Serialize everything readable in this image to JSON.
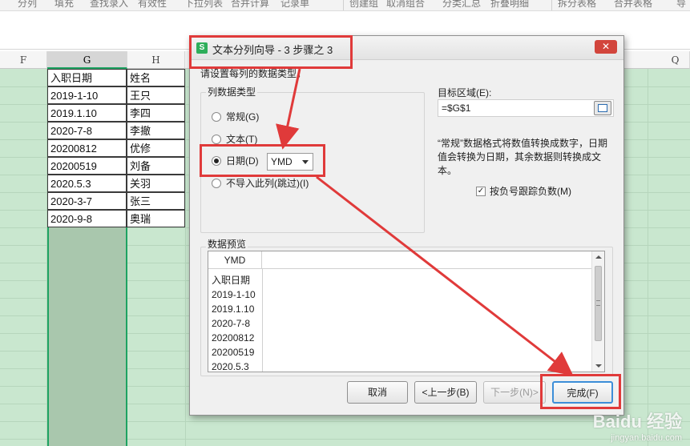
{
  "ribbon": {
    "items": [
      "分列",
      "填充",
      "查找录入",
      "有效性",
      "下拉列表",
      "合并计算",
      "记录单",
      "创建组",
      "取消组合",
      "分类汇总",
      "折叠明细",
      "拆分表格",
      "合并表格",
      "导"
    ]
  },
  "sheet": {
    "columns": [
      "F",
      "G",
      "H",
      "Q"
    ],
    "selected_column": "G",
    "rows": [
      {
        "g": "入职日期",
        "h": "姓名"
      },
      {
        "g": "2019-1-10",
        "h": "王只"
      },
      {
        "g": "2019.1.10",
        "h": "李四"
      },
      {
        "g": "2020-7-8",
        "h": "李撤"
      },
      {
        "g": "20200812",
        "h": "优修"
      },
      {
        "g": "20200519",
        "h": "刘备"
      },
      {
        "g": "2020.5.3",
        "h": "关羽"
      },
      {
        "g": "2020-3-7",
        "h": "张三"
      },
      {
        "g": "2020-9-8",
        "h": "奥瑞"
      }
    ]
  },
  "dialog": {
    "app_icon": "S",
    "title": "文本分列向导 - 3 步骤之 3",
    "close_label": "✕",
    "prompt": "请设置每列的数据类型。",
    "column_type_group": "列数据类型",
    "options": [
      {
        "label": "常规(G)",
        "checked": false
      },
      {
        "label": "文本(T)",
        "checked": false
      },
      {
        "label": "日期(D)",
        "checked": true
      },
      {
        "label": "不导入此列(跳过)(I)",
        "checked": false
      }
    ],
    "date_format": "YMD",
    "destination_label": "目标区域(E):",
    "destination_value": "=$G$1",
    "description": "“常规”数据格式将数值转换成数字，日期值会转换为日期，其余数据则转换成文本。",
    "checkbox_label": "按负号跟踪负数(M)",
    "checkbox_checked": true,
    "checkbox_mark": "✓",
    "preview_group": "数据预览",
    "preview_header": "YMD",
    "preview_rows": [
      "入职日期",
      "2019-1-10",
      "2019.1.10",
      "2020-7-8",
      "20200812",
      "20200519",
      "2020.5.3"
    ],
    "buttons": {
      "cancel": "取消",
      "back": "<上一步(B)",
      "next": "下一步(N)>",
      "finish": "完成(F)"
    }
  },
  "watermark": {
    "main": "Baidu 经验",
    "sub": "jingyan.baidu.com"
  },
  "colors": {
    "sheet_selected": "#c9e7cf",
    "selection_border": "#1ea362",
    "annotation_red": "#e03a3a",
    "primary_button_border": "#3c8ed8"
  }
}
